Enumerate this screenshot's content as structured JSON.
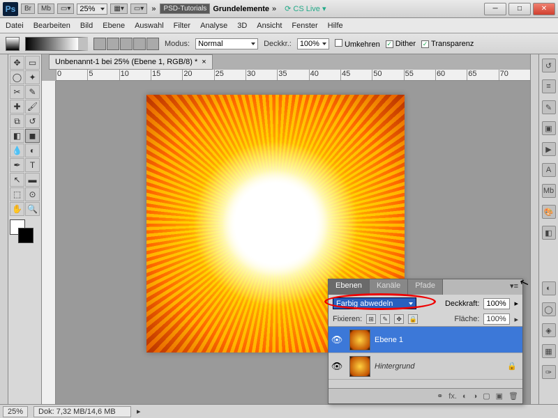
{
  "titlebar": {
    "br": "Br",
    "mb": "Mb",
    "zoom": "25%",
    "tutorials": "PSD-Tutorials",
    "workspace": "Grundelemente",
    "cslive": "CS Live"
  },
  "menu": {
    "datei": "Datei",
    "bearbeiten": "Bearbeiten",
    "bild": "Bild",
    "ebene": "Ebene",
    "auswahl": "Auswahl",
    "filter": "Filter",
    "analyse": "Analyse",
    "d3": "3D",
    "ansicht": "Ansicht",
    "fenster": "Fenster",
    "hilfe": "Hilfe"
  },
  "opts": {
    "modus": "Modus:",
    "modus_val": "Normal",
    "deckkr": "Deckkr.:",
    "deckkr_val": "100%",
    "umkehren": "Umkehren",
    "dither": "Dither",
    "transparenz": "Transparenz"
  },
  "doc": {
    "tab": "Unbenannt-1 bei 25% (Ebene 1, RGB/8) *",
    "close": "×"
  },
  "status": {
    "zoom": "25%",
    "dok": "Dok: 7,32 MB/14,6 MB"
  },
  "layers": {
    "tab_ebenen": "Ebenen",
    "tab_kanale": "Kanäle",
    "tab_pfade": "Pfade",
    "blend": "Farbig abwedeln",
    "deckkraft_lbl": "Deckkraft:",
    "deckkraft_val": "100%",
    "fixieren": "Fixieren:",
    "flaeche_lbl": "Fläche:",
    "flaeche_val": "100%",
    "l1": "Ebene 1",
    "l2": "Hintergrund"
  },
  "ruler": [
    "0",
    "5",
    "10",
    "15",
    "20",
    "25",
    "30",
    "35",
    "40",
    "45",
    "50",
    "55",
    "60",
    "65",
    "70"
  ]
}
